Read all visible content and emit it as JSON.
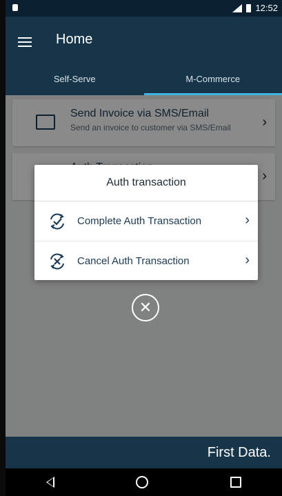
{
  "status_bar": {
    "time": "12:52"
  },
  "app_bar": {
    "title": "Home"
  },
  "tabs": [
    {
      "label": "Self-Serve"
    },
    {
      "label": "M-Commerce"
    }
  ],
  "cards": [
    {
      "title": "Send Invoice via SMS/Email",
      "subtitle": "Send an invoice to customer via SMS/Email"
    },
    {
      "title": "Auth Transaction",
      "subtitle": ""
    }
  ],
  "dialog": {
    "title": "Auth transaction",
    "items": [
      {
        "label": "Complete Auth Transaction",
        "icon": "complete-auth-icon"
      },
      {
        "label": "Cancel Auth Transaction",
        "icon": "cancel-auth-icon"
      }
    ]
  },
  "close_symbol": "✕",
  "brand": {
    "text": "First Data."
  },
  "colors": {
    "primary": "#173549",
    "accent": "#41b4e5",
    "background": "#eceeef"
  }
}
